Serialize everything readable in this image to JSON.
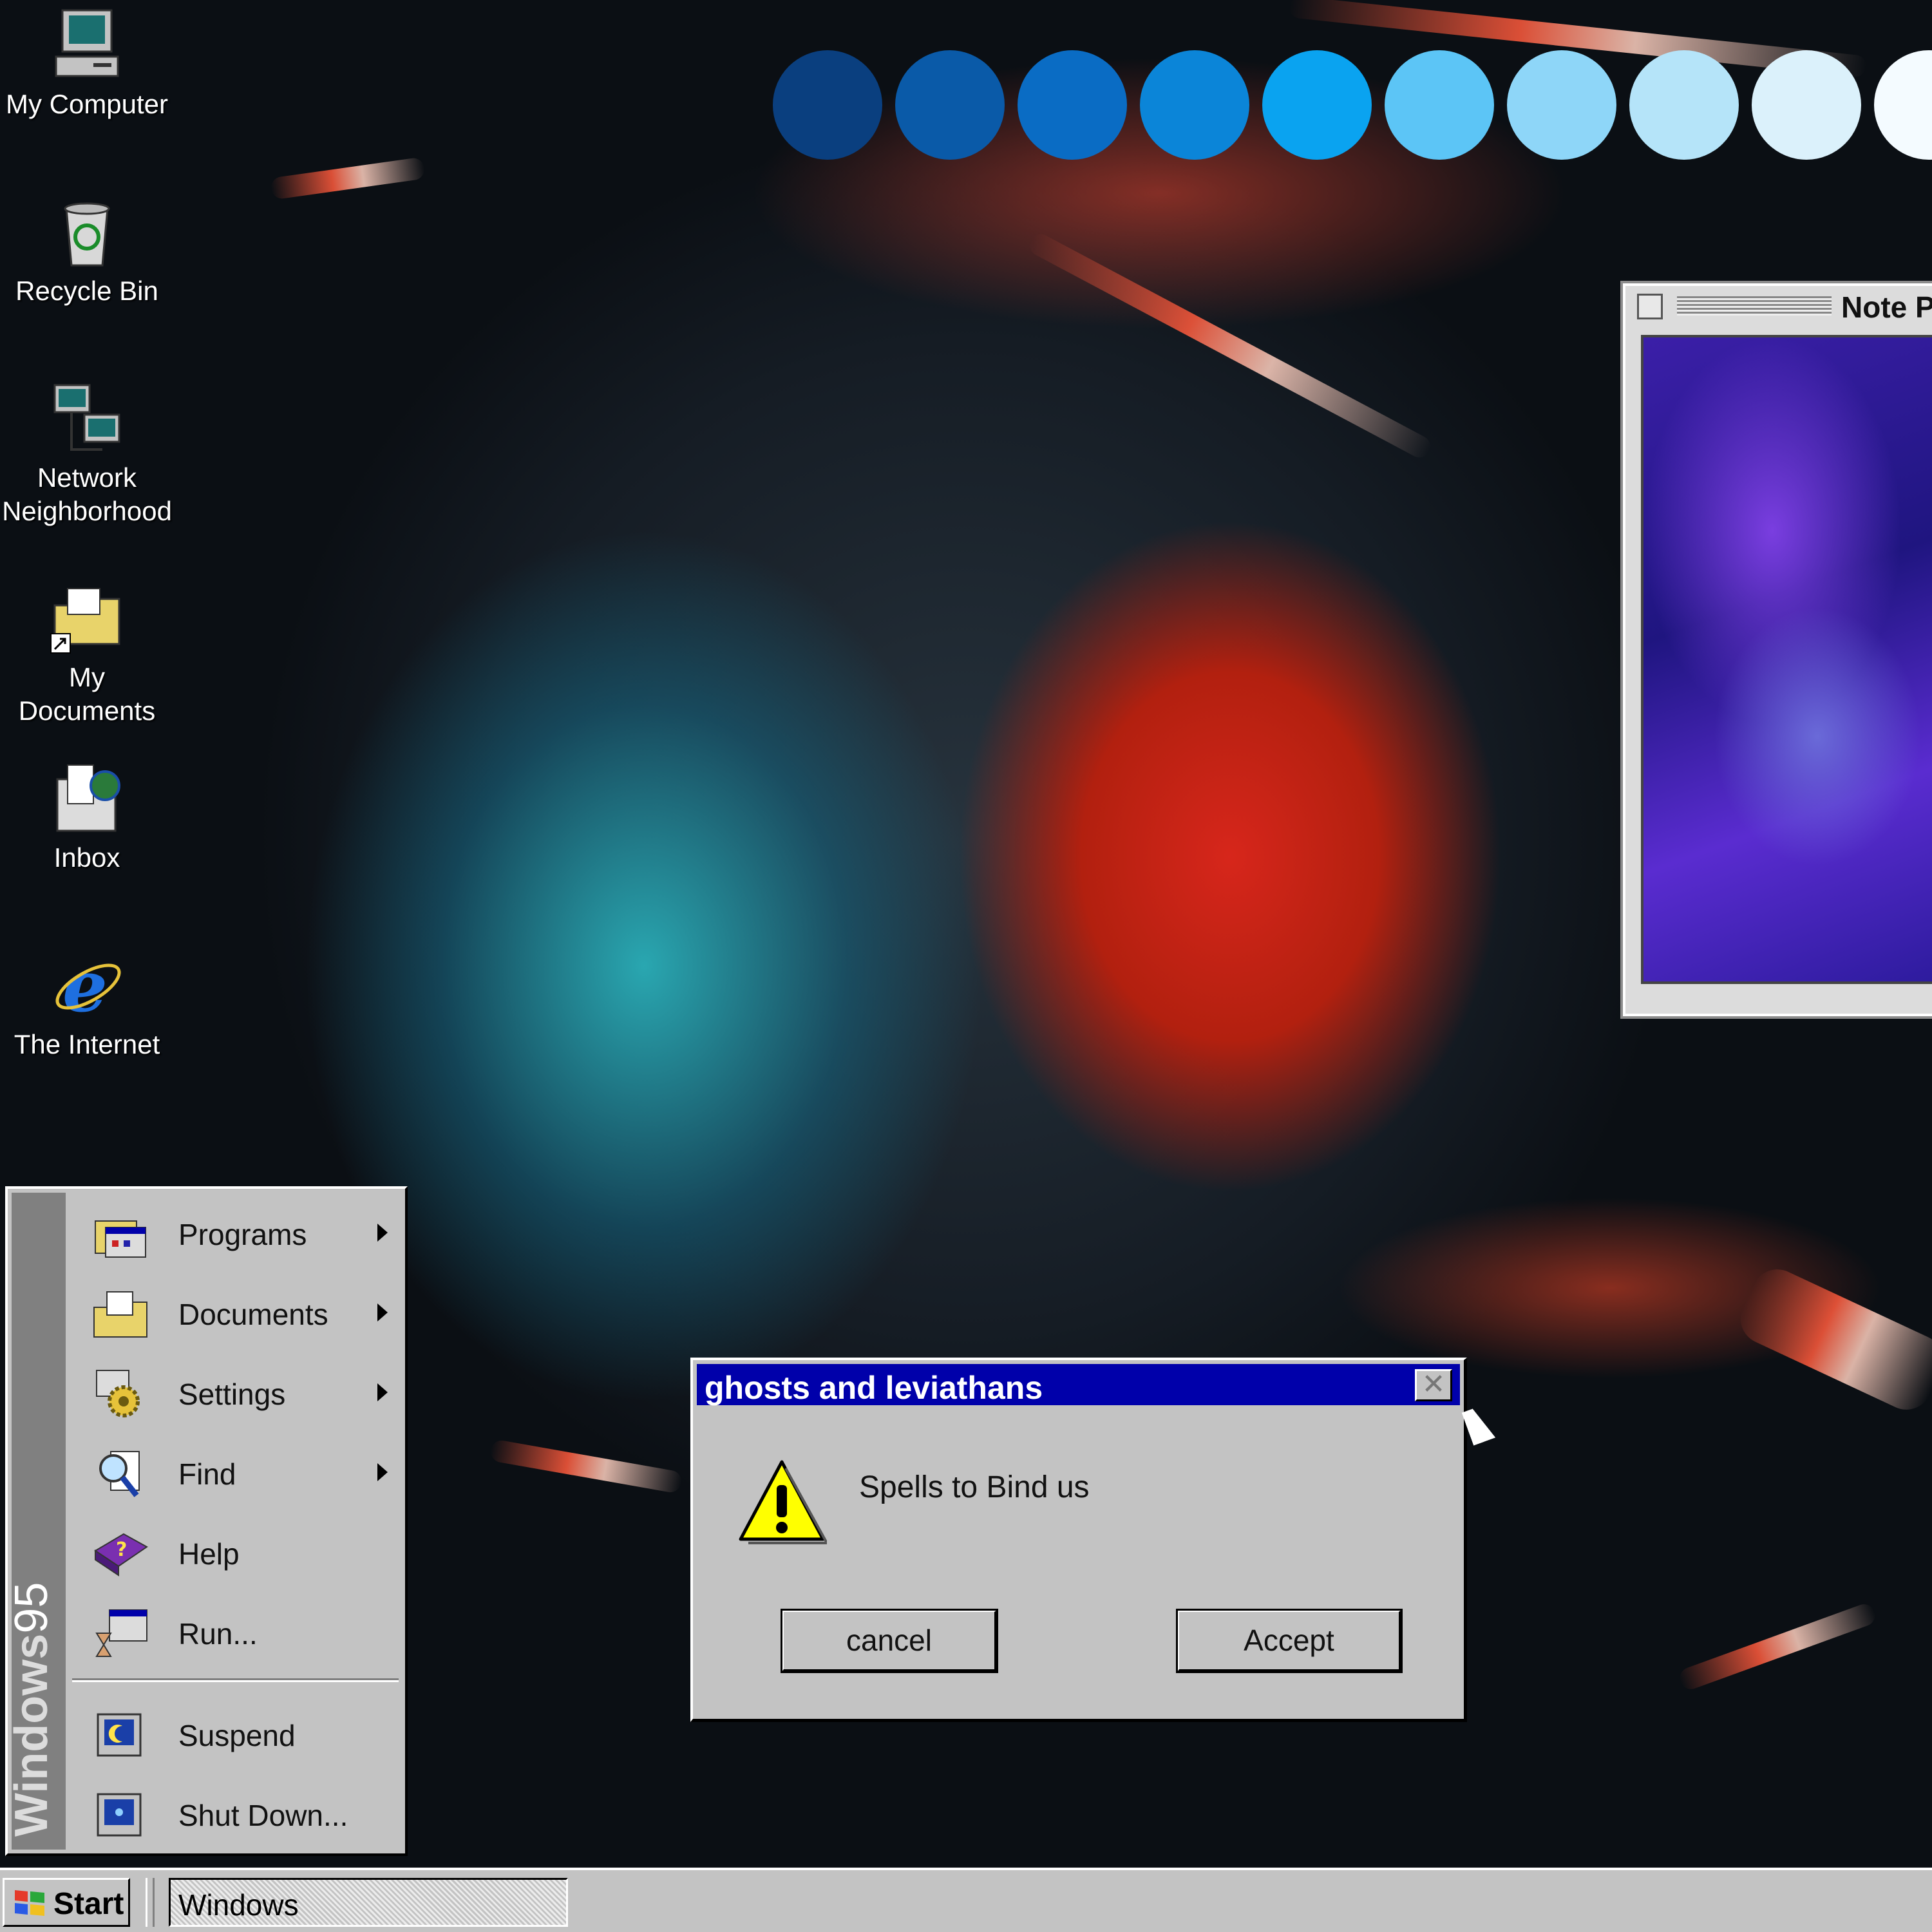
{
  "desktop": {
    "icons": [
      {
        "label": "My Computer",
        "icon": "my-computer-icon"
      },
      {
        "label": "Recycle Bin",
        "icon": "recycle-bin-icon"
      },
      {
        "label": "Network\nNeighborhood",
        "icon": "network-neighborhood-icon"
      },
      {
        "label": "My Documents",
        "icon": "my-documents-icon"
      },
      {
        "label": "Inbox",
        "icon": "inbox-icon"
      },
      {
        "label": "The Internet",
        "icon": "internet-explorer-icon"
      }
    ],
    "decorative_circle_colors": [
      "#0a3f7f",
      "#0a5aa8",
      "#0a6cc4",
      "#0b85d8",
      "#0aa3f0",
      "#5cc5f6",
      "#8ed6f8",
      "#b5e4f9",
      "#dbf1fb",
      "#f4fbff"
    ]
  },
  "note_window": {
    "title": "Note P"
  },
  "start_menu": {
    "banner_bold": "Windows",
    "banner_light": "95",
    "items": [
      {
        "label": "Programs",
        "icon": "programs-icon",
        "submenu": true
      },
      {
        "label": "Documents",
        "icon": "documents-icon",
        "submenu": true
      },
      {
        "label": "Settings",
        "icon": "settings-icon",
        "submenu": true
      },
      {
        "label": "Find",
        "icon": "find-icon",
        "submenu": true
      },
      {
        "label": "Help",
        "icon": "help-icon",
        "submenu": false
      },
      {
        "label": "Run...",
        "icon": "run-icon",
        "submenu": false
      },
      {
        "label": "Suspend",
        "icon": "suspend-icon",
        "submenu": false
      },
      {
        "label": "Shut Down...",
        "icon": "shut-down-icon",
        "submenu": false
      }
    ]
  },
  "dialog": {
    "title": "ghosts and leviathans",
    "close_glyph": "✕",
    "message": "Spells to Bind us",
    "icon": "warning-icon",
    "buttons": {
      "cancel": "cancel",
      "accept": "Accept"
    }
  },
  "taskbar": {
    "start_label": "Start",
    "window_button_label": "Windows"
  },
  "colors": {
    "titlebar": "#0000aa",
    "chrome": "#c3c3c3"
  }
}
